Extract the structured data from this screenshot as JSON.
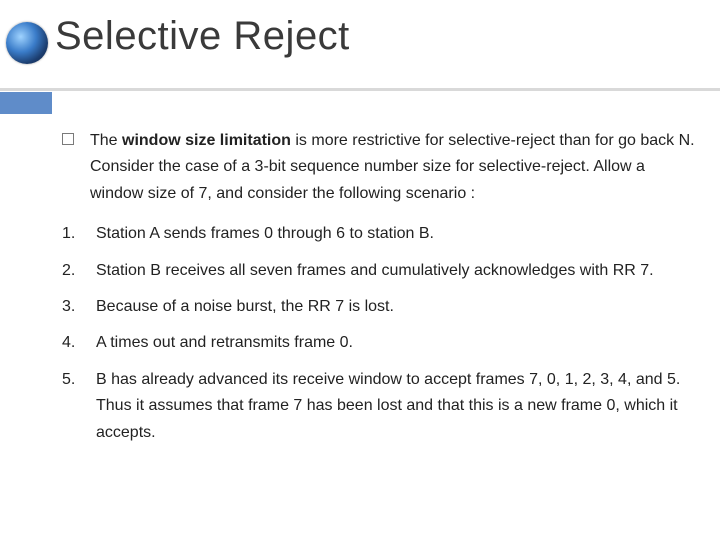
{
  "title": "Selective Reject",
  "intro": {
    "lead": "The ",
    "strong": "window size limitation",
    "rest": " is more restrictive for selective-reject than for go back N. Consider the case of a 3-bit sequence number size for selective-reject. Allow a window size of 7, and consider the following scenario :"
  },
  "steps": [
    {
      "n": "1.",
      "text": "Station A sends frames 0 through 6 to station B."
    },
    {
      "n": "2.",
      "text": "Station B receives all seven frames and cumulatively acknowledges with RR 7."
    },
    {
      "n": "3.",
      "text": "Because of a noise burst, the RR 7 is lost."
    },
    {
      "n": "4.",
      "text": "A times out and retransmits frame 0."
    },
    {
      "n": "5.",
      "text": "B has already advanced its receive window to accept frames 7, 0, 1, 2, 3, 4, and 5. Thus it assumes that frame 7 has been lost and that this is a new frame 0, which it accepts."
    }
  ]
}
